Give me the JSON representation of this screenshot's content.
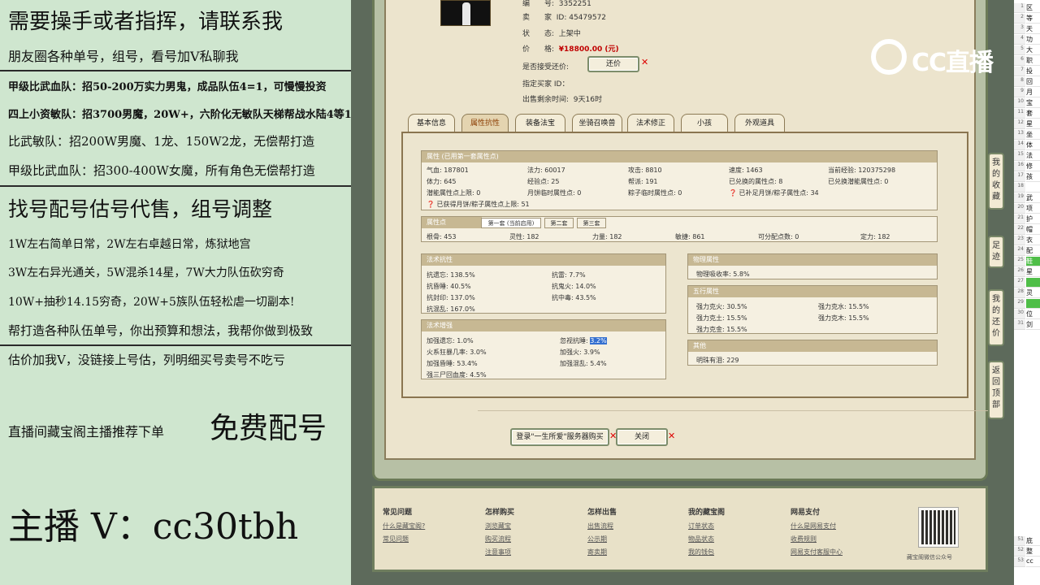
{
  "ad": {
    "lines": [
      "需要操手或者指挥，请联系我",
      "朋友圈各种单号，组号，看号加V私聊我",
      "甲级比武血队：招50-200万实力男鬼，成品队伍4=1，可慢慢投资",
      "四上小资敏队：招3700男魔，20W+，六阶化无敏队天梯帮战水陆4等1",
      "比武敏队：招200W男魔、1龙、150W2龙，无偿帮打造",
      "甲级比武血队：招300-400W女魔，所有角色无偿帮打造",
      "找号配号估号代售，组号调整",
      "1W左右简单日常，2W左右卓越日常，炼狱地宫",
      "3W左右异光通关，5W混杀14星，7W大力队伍砍穷奇",
      "10W+抽秒14.15穷奇，20W+5族队伍轻松虐一切副本!",
      "帮打造各种队伍单号，你出预算和想法，我帮你做到极致",
      "估价加我V，没链接上号估，列明细买号卖号不吃亏"
    ],
    "promo_small": "直播间藏宝阁主播推荐下单",
    "promo_big": "免费配号",
    "anchor": "主播 V：cc30tbh"
  },
  "item": {
    "fields": [
      {
        "label": "编　　号:",
        "value": "3352251"
      },
      {
        "label": "卖　　家",
        "value": "ID:  45479572"
      },
      {
        "label": "状　　态:",
        "value": "上架中"
      },
      {
        "label": "价　　格:",
        "value": "¥18800.00 (元)"
      },
      {
        "label": "是否接受还价:",
        "value": ""
      },
      {
        "label": "指定买家 ID：",
        "value": ""
      },
      {
        "label": "出售剩余时间:",
        "value": "9天16时"
      }
    ],
    "bargain_button": "还价"
  },
  "tabs": [
    "基本信息",
    "属性抗性",
    "装备法宝",
    "坐骑召唤兽",
    "法术修正",
    "小孩",
    "外观道具"
  ],
  "attr": {
    "title": "属性 (已用第一套属性点)",
    "row1": [
      "气血: 187801",
      "法力: 60017",
      "攻击: 8810",
      "速度: 1463",
      "当前经验: 120375298"
    ],
    "row2": [
      "体力: 645",
      "经验点: 25",
      "帮派: 191",
      "已兑换的属性点: 8",
      "已兑换潜能属性点: 0"
    ],
    "row3": [
      "潜能属性点上限: 0",
      "月饼临时属性点: 0",
      "粽子临时属性点: 0",
      "已补足月饼/粽子属性点: 34"
    ],
    "row4": "已获得月饼/粽子属性点上限: 51"
  },
  "points": {
    "title": "属性点",
    "subtabs": [
      "第一套 (当前启用)",
      "第二套",
      "第三套"
    ],
    "values": [
      "根骨: 453",
      "灵性: 182",
      "力量: 182",
      "敏捷: 861",
      "可分配点数: 0",
      "定力: 182"
    ]
  },
  "resist": {
    "title": "法术抗性",
    "rows": [
      [
        "抗遗忘: 138.5%",
        "抗雷: 7.7%"
      ],
      [
        "抗昏睡: 40.5%",
        "抗鬼火: 14.0%"
      ],
      [
        "抗封印: 137.0%",
        "抗中毒: 43.5%"
      ],
      [
        "抗混乱: 167.0%",
        ""
      ]
    ]
  },
  "boost": {
    "title": "法术增强",
    "rows": [
      [
        "加强遗忘: 1.0%",
        "忽视抗睡: 3.2%"
      ],
      [
        "火系狂暴几率: 3.0%",
        "加强火: 3.9%"
      ],
      [
        "加强昏睡: 53.4%",
        "加强混乱: 5.4%"
      ],
      [
        "强三尸回血度: 4.5%",
        ""
      ]
    ]
  },
  "phys": {
    "title": "物理属性",
    "rows": [
      "物理吸收率: 5.8%"
    ]
  },
  "five": {
    "title": "五行属性",
    "rows": [
      [
        "强力克火: 30.5%",
        "强力克水: 15.5%"
      ],
      [
        "强力克土: 15.5%",
        "强力克木: 15.5%"
      ],
      [
        "强力克金: 15.5%",
        ""
      ]
    ]
  },
  "other": {
    "title": "其他",
    "rows": [
      "明珠有泪: 229"
    ]
  },
  "actions": {
    "login_buy": "登录\"一生所爱\"服务器购买",
    "close": "关闭"
  },
  "footer": {
    "cols": [
      {
        "h": "常见问题",
        "items": [
          "什么是藏宝阁?",
          "常见问题"
        ]
      },
      {
        "h": "怎样购买",
        "items": [
          "浏览藏宝",
          "购买流程",
          "注意事项"
        ]
      },
      {
        "h": "怎样出售",
        "items": [
          "出售流程",
          "公示期",
          "寄卖期"
        ]
      },
      {
        "h": "我的藏宝阁",
        "items": [
          "订单状态",
          "物品状态",
          "我的钱包"
        ]
      },
      {
        "h": "网易支付",
        "items": [
          "什么是网易支付",
          "收费规则",
          "网易支付客服中心"
        ]
      }
    ],
    "qr_caption": "藏宝阁微信公众号"
  },
  "side": [
    "我的收藏",
    "足迹",
    "我的还价",
    "返回顶部"
  ],
  "logo_text": "CC直播",
  "sheet": {
    "rows": [
      "1",
      "2",
      "3",
      "4",
      "5",
      "6",
      "7",
      "8",
      "9",
      "10",
      "11",
      "12",
      "13",
      "14",
      "15",
      "16",
      "17",
      "18",
      "19",
      "20",
      "21",
      "22",
      "23",
      "24",
      "25",
      "26",
      "27",
      "28",
      "29",
      "30",
      "31"
    ],
    "cells": [
      "区",
      "等",
      "天",
      "功",
      "大",
      "职",
      "投",
      "回",
      "月",
      "宝",
      "套",
      "星",
      "坐",
      "体",
      "法",
      "修",
      "孩",
      "",
      "武",
      "项",
      "护",
      "帽",
      "衣",
      "配",
      "鞋",
      "星",
      "",
      "灵",
      "",
      "位",
      "剑"
    ],
    "bottom_rows": [
      "51",
      "52",
      "53"
    ],
    "bottom_cells": [
      "底",
      "整",
      "cc"
    ]
  }
}
